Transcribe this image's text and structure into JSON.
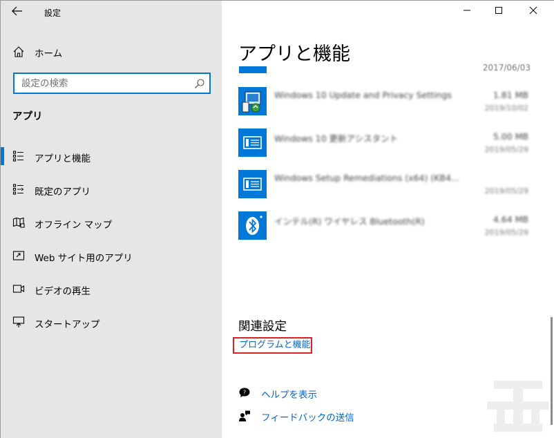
{
  "window": {
    "title": "設定",
    "controls": {
      "minimize": "—",
      "maximize": "☐",
      "close": "✕"
    }
  },
  "sidebar": {
    "back_icon": "back-arrow-icon",
    "home_label": "ホーム",
    "search": {
      "placeholder": "設定の検索",
      "icon": "search-icon"
    },
    "section_title": "アプリ",
    "items": [
      {
        "label": "アプリと機能",
        "icon": "apps-features-icon",
        "selected": true
      },
      {
        "label": "既定のアプリ",
        "icon": "default-apps-icon",
        "selected": false
      },
      {
        "label": "オフライン マップ",
        "icon": "offline-maps-icon",
        "selected": false
      },
      {
        "label": "Web サイト用のアプリ",
        "icon": "apps-for-websites-icon",
        "selected": false
      },
      {
        "label": "ビデオの再生",
        "icon": "video-playback-icon",
        "selected": false
      },
      {
        "label": "スタートアップ",
        "icon": "startup-icon",
        "selected": false
      }
    ]
  },
  "main": {
    "page_title": "アプリと機能",
    "partial_top_date": "2017/06/03",
    "apps": [
      {
        "name": "Windows 10 Update and Privacy Settings",
        "size": "1.81 MB",
        "date": "2019/10/02",
        "icon": "windows-update-icon"
      },
      {
        "name": "Windows 10 更新アシスタント",
        "size": "5.00 MB",
        "date": "2019/05/29",
        "icon": "windows-app-icon"
      },
      {
        "name": "Windows Setup Remediations (x64) (KB4...",
        "size": "",
        "date": "2019/05/29",
        "icon": "windows-app-icon"
      },
      {
        "name": "インテル(R) ワイヤレス Bluetooth(R)",
        "size": "4.64 MB",
        "date": "2019/05/29",
        "icon": "bluetooth-icon"
      }
    ],
    "related": {
      "title": "関連設定",
      "programs_link": "プログラムと機能"
    },
    "help": {
      "label": "ヘルプを表示",
      "icon": "help-chat-icon"
    },
    "feedback": {
      "label": "フィードバックの送信",
      "icon": "feedback-icon"
    }
  },
  "colors": {
    "accent": "#0078d7",
    "sidebar_bg": "#e6e6e6",
    "link": "#0066cc",
    "highlight_border": "#e02020"
  }
}
